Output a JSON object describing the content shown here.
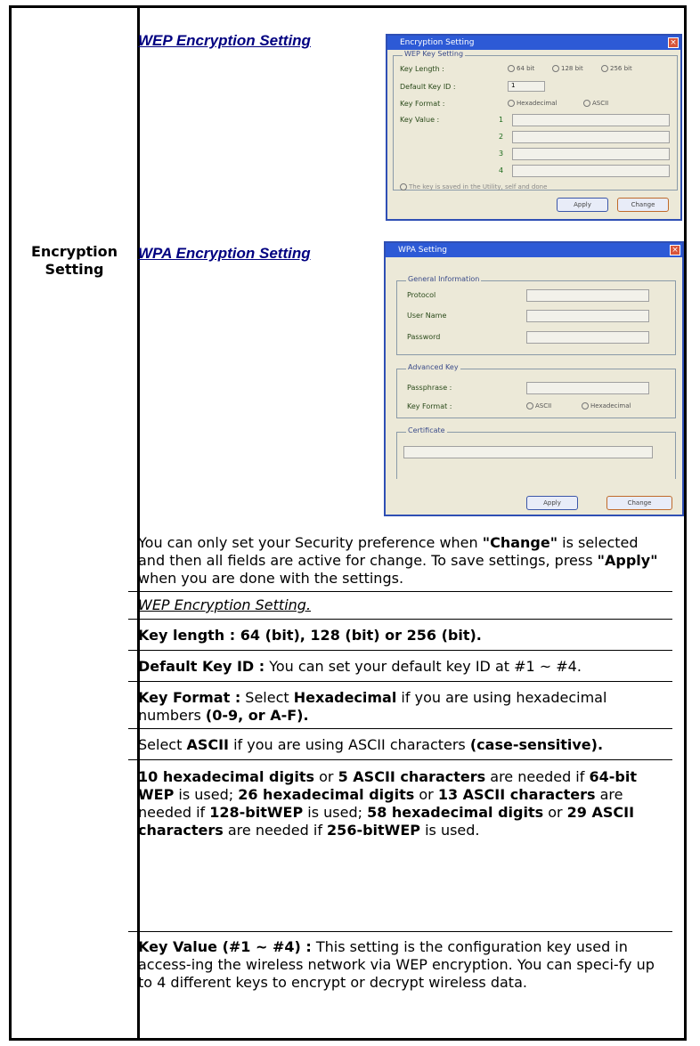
{
  "row_label": [
    "Encryption",
    "Setting"
  ],
  "wep_title": "WEP Encryption Setting",
  "wpa_title": "WPA Encryption Setting",
  "intro": {
    "t1": "You can only set your Security preference when ",
    "change": "\"Change\"",
    "t2": " is selected and then all fields are active for change. To save settings, press ",
    "apply": "\"Apply\"",
    "t3": " when you are done with the settings."
  },
  "wep_heading": "WEP Encryption Setting.",
  "key_length": "Key length : 64 (bit), 128 (bit) or 256 (bit).",
  "default_key": {
    "label": "Default Key ID :",
    "text": " You can set your default key ID at #1 ~ #4."
  },
  "key_format": {
    "label": "Key Format :",
    "t1": " Select ",
    "hex": "Hexadecimal",
    "t2": " if you are using hexadecimal numbers ",
    "range": "(0-9, or A-F)."
  },
  "ascii_line": {
    "t1": "Select ",
    "ascii": "ASCII",
    "t2": " if you are using ASCII characters ",
    "cs": "(case-sensitive)."
  },
  "digits": {
    "a": "10 hexadecimal digits",
    "b": " or ",
    "c": "5 ASCII characters",
    "d": " are needed if ",
    "e": "64-bit WEP",
    "f": " is used; ",
    "g": "26 hexadecimal digits",
    "h": " or ",
    "i": "13 ASCII characters",
    "j": " are needed if ",
    "k": "128-bitWEP",
    "l": " is used; ",
    "m": "58 hexadecimal digits",
    "n": " or ",
    "o": "29 ASCII characters",
    "p": " are needed if ",
    "q": "256-bitWEP",
    "r": " is used."
  },
  "key_value": {
    "label": "Key Value (#1 ~ #4) :",
    "text": " This setting is the configuration key used in access-ing the wireless network via WEP encryption. You can speci-fy up to 4 different keys to encrypt or decrypt wireless data."
  },
  "wep_dialog": {
    "title": "Encryption Setting",
    "group": "WEP Key Setting",
    "labels": [
      "Key Length :",
      "Default Key ID :",
      "Key Format :",
      "Key Value :"
    ],
    "length_opts": [
      "64 bit",
      "128 bit",
      "256 bit"
    ],
    "format_opts": [
      "Hexadecimal",
      "ASCII"
    ],
    "default_id": "1",
    "key_nums": [
      "1",
      "2",
      "3",
      "4"
    ],
    "note": "The key is saved in the Utility, self and done",
    "buttons": [
      "Apply",
      "Change"
    ]
  },
  "wpa_dialog": {
    "title": "WPA Setting",
    "group1": "General Information",
    "labels1": [
      "Protocol",
      "User Name",
      "Password"
    ],
    "group2": "Advanced Key",
    "labels2": [
      "Passphrase :",
      "Key Format :"
    ],
    "format_opts": [
      "ASCII",
      "Hexadecimal"
    ],
    "group3": "Certificate",
    "buttons": [
      "Apply",
      "Change"
    ]
  }
}
